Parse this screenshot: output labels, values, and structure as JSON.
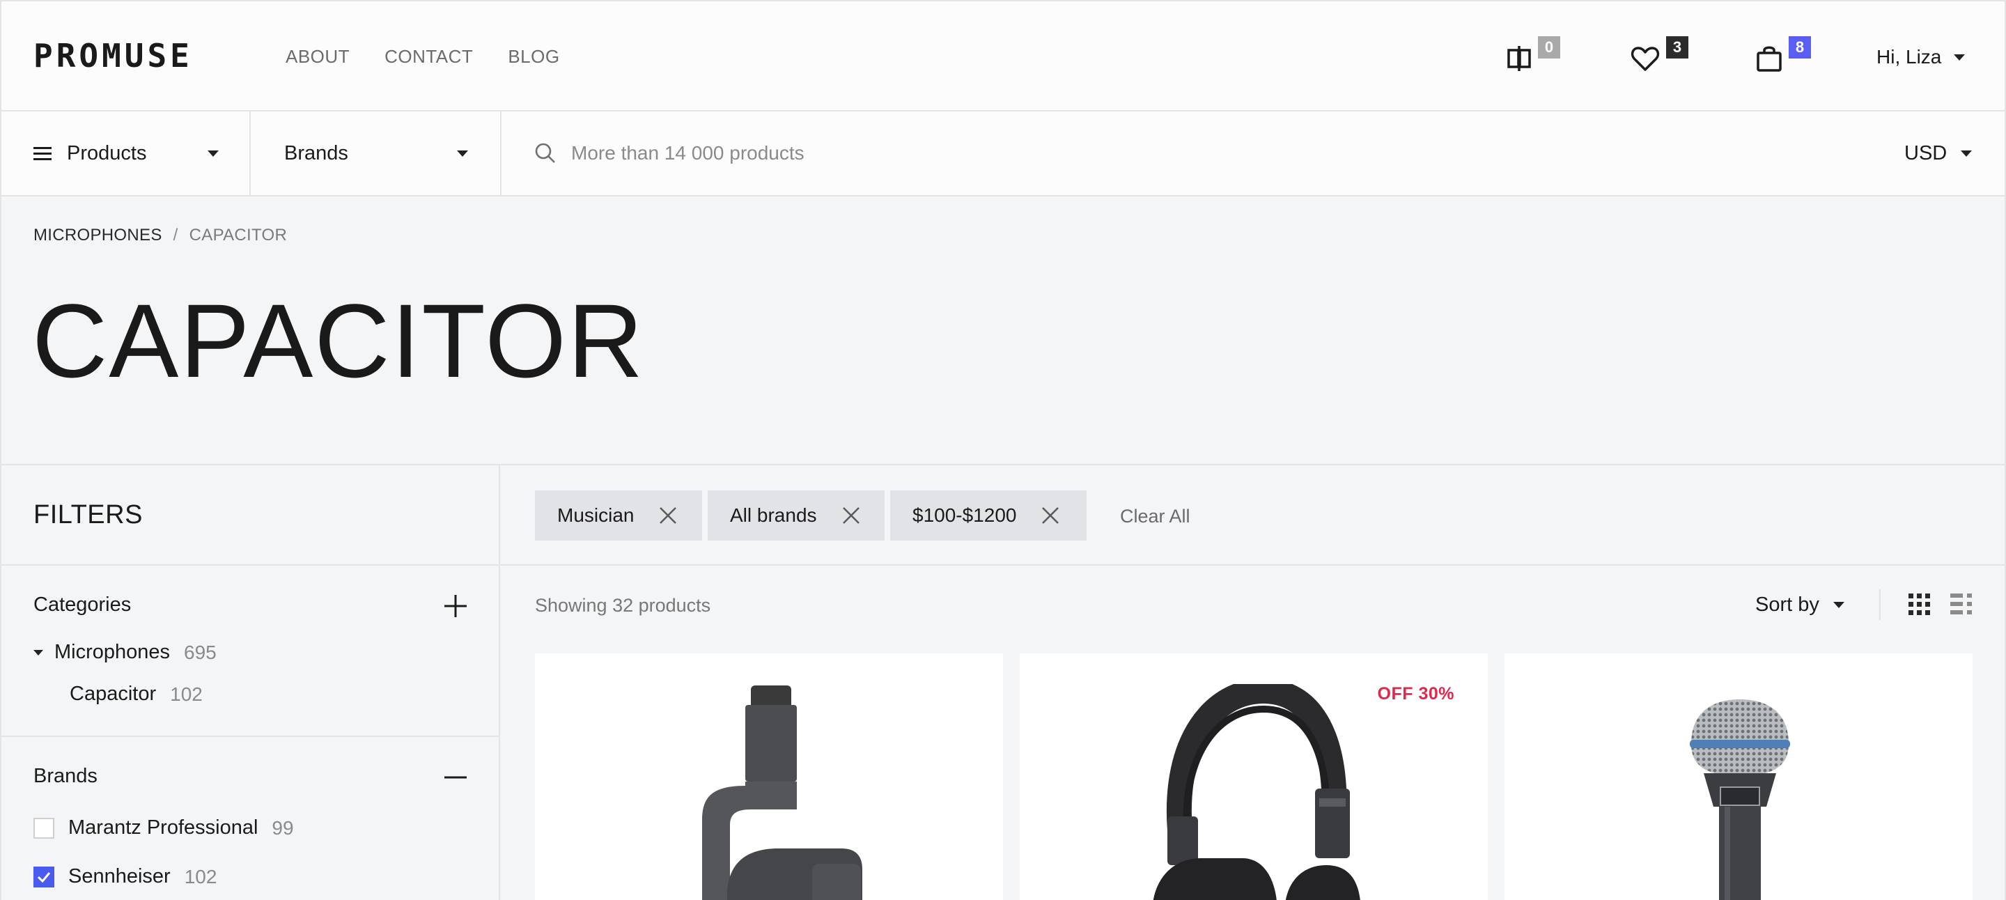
{
  "header": {
    "logo": "PROMUSE",
    "nav": [
      {
        "label": "ABOUT"
      },
      {
        "label": "CONTACT"
      },
      {
        "label": "BLOG"
      }
    ],
    "compare_count": "0",
    "wishlist_count": "3",
    "cart_count": "8",
    "user_greeting": "Hi, Liza",
    "colors": {
      "compare_badge": "#a9a9a9",
      "wishlist_badge": "#2b2b2b",
      "cart_badge": "#5b5ef5"
    }
  },
  "subbar": {
    "products_label": "Products",
    "brands_label": "Brands",
    "search_placeholder": "More than 14 000 products",
    "currency": "USD"
  },
  "breadcrumb": {
    "items": [
      "MICROPHONES",
      "CAPACITOR"
    ],
    "separator": "/"
  },
  "page_title": "CAPACITOR",
  "filters": {
    "title": "FILTERS",
    "categories": {
      "title": "Categories",
      "items": [
        {
          "label": "Microphones",
          "count": "695"
        },
        {
          "label": "Capacitor",
          "count": "102"
        }
      ]
    },
    "brands": {
      "title": "Brands",
      "items": [
        {
          "label": "Marantz Professional",
          "count": "99",
          "checked": false
        },
        {
          "label": "Sennheiser",
          "count": "102",
          "checked": true
        }
      ]
    }
  },
  "active_filters": {
    "chips": [
      {
        "label": "Musician"
      },
      {
        "label": "All brands"
      },
      {
        "label": "$100-$1200"
      }
    ],
    "clear_all": "Clear All"
  },
  "results": {
    "showing": "Showing 32 products",
    "sort_label": "Sort by"
  },
  "products": [
    {
      "icon": "boom-arm-microphone"
    },
    {
      "icon": "headphones",
      "sale": "OFF 30%"
    },
    {
      "icon": "dynamic-microphone"
    }
  ],
  "accent_color": "#4a5cf0",
  "sale_color": "#e0284c"
}
